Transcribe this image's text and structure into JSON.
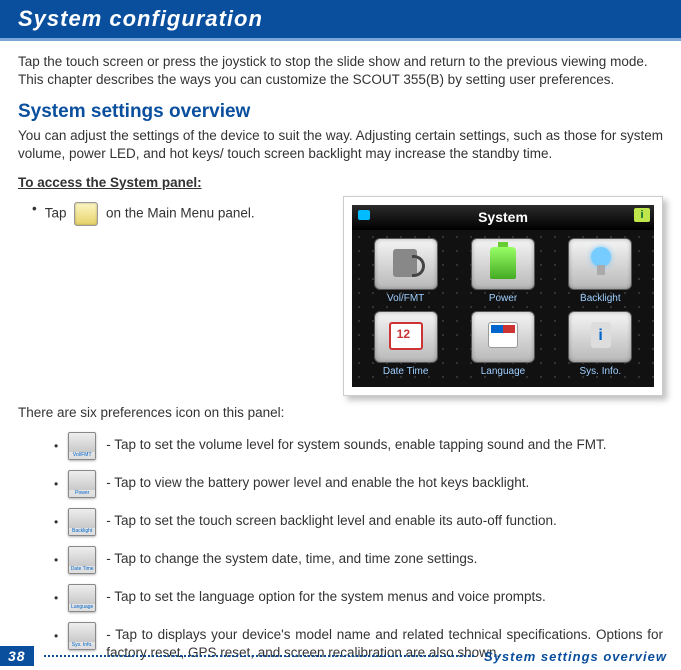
{
  "header": {
    "title": "System configuration"
  },
  "intro": {
    "line1": "Tap the touch screen or press the joystick to stop the slide show and return to the previous viewing mode.",
    "line2": "This chapter describes the ways you can customize the SCOUT 355(B) by setting user preferences."
  },
  "section": {
    "heading": "System settings overview",
    "body": "You can adjust the settings of the device to suit the way. Adjusting certain settings, such as those for system volume, power LED, and hot keys/ touch screen backlight may increase the standby time."
  },
  "access": {
    "title": "To access the System panel:",
    "tap_prefix": "Tap",
    "tap_suffix": "on the Main Menu panel."
  },
  "system_panel": {
    "title": "System",
    "items": [
      {
        "label": "Vol/FMT"
      },
      {
        "label": "Power"
      },
      {
        "label": "Backlight"
      },
      {
        "label": "Date Time"
      },
      {
        "label": "Language"
      },
      {
        "label": "Sys. Info."
      }
    ]
  },
  "preferences": {
    "intro": "There are six preferences icon on this panel:",
    "items": [
      {
        "icon_caption": "Vol/FMT",
        "text": "- Tap to set the volume level for system sounds, enable tapping sound and the FMT."
      },
      {
        "icon_caption": "Power",
        "text": "- Tap to view the battery power level and enable the hot keys backlight."
      },
      {
        "icon_caption": "Backlight",
        "text": "- Tap to set the touch screen backlight level and enable its auto-off function."
      },
      {
        "icon_caption": "Date Time",
        "text": "- Tap to change the system date, time, and time zone settings."
      },
      {
        "icon_caption": "Language",
        "text": "- Tap to set the language option for the system menus and voice prompts."
      },
      {
        "icon_caption": "Sys. Info.",
        "text": "- Tap to displays your device's model name and related technical specifications. Options for factory reset, GPS reset, and screen recalibration are also shown."
      }
    ]
  },
  "footer": {
    "page": "38",
    "section": "System settings overview"
  }
}
